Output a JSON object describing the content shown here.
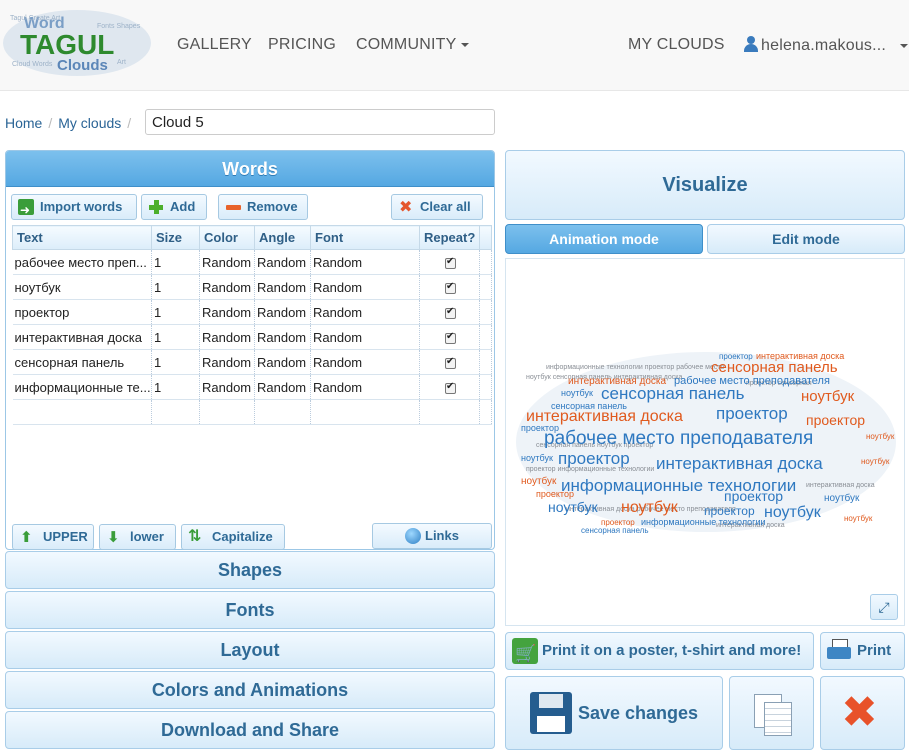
{
  "nav": {
    "logo_text": "Word TAGUL Clouds",
    "gallery": "GALLERY",
    "pricing": "PRICING",
    "community": "COMMUNITY",
    "my_clouds": "MY CLOUDS",
    "user": "helena.makous..."
  },
  "breadcrumb": {
    "home": "Home",
    "my_clouds": "My clouds",
    "cloud_name": "Cloud 5"
  },
  "words_panel": {
    "title": "Words",
    "import": "Import words",
    "add": "Add",
    "remove": "Remove",
    "clear_all": "Clear all",
    "columns": [
      "Text",
      "Size",
      "Color",
      "Angle",
      "Font",
      "Repeat?"
    ],
    "rows": [
      {
        "text": "рабочее место преп...",
        "size": "1",
        "color": "Random",
        "angle": "Random",
        "font": "Random",
        "repeat": true
      },
      {
        "text": "ноутбук",
        "size": "1",
        "color": "Random",
        "angle": "Random",
        "font": "Random",
        "repeat": true
      },
      {
        "text": "проектор",
        "size": "1",
        "color": "Random",
        "angle": "Random",
        "font": "Random",
        "repeat": true
      },
      {
        "text": "интерактивная доска",
        "size": "1",
        "color": "Random",
        "angle": "Random",
        "font": "Random",
        "repeat": true
      },
      {
        "text": "сенсорная панель",
        "size": "1",
        "color": "Random",
        "angle": "Random",
        "font": "Random",
        "repeat": true
      },
      {
        "text": "информационные те...",
        "size": "1",
        "color": "Random",
        "angle": "Random",
        "font": "Random",
        "repeat": true
      }
    ],
    "upper": "UPPER",
    "lower": "lower",
    "capitalize": "Capitalize",
    "links": "Links"
  },
  "accordion": {
    "shapes": "Shapes",
    "fonts": "Fonts",
    "layout": "Layout",
    "colors": "Colors and Animations",
    "download": "Download and Share"
  },
  "right": {
    "visualize": "Visualize",
    "animation_mode": "Animation mode",
    "edit_mode": "Edit mode",
    "print_poster": "Print it on a poster, t-shirt and more!",
    "print": "Print",
    "save": "Save changes"
  },
  "colors": {
    "blue": "#2e78c0",
    "orange": "#e05a1e",
    "light_blue": "#7aaede",
    "gray": "#8a8f96"
  }
}
